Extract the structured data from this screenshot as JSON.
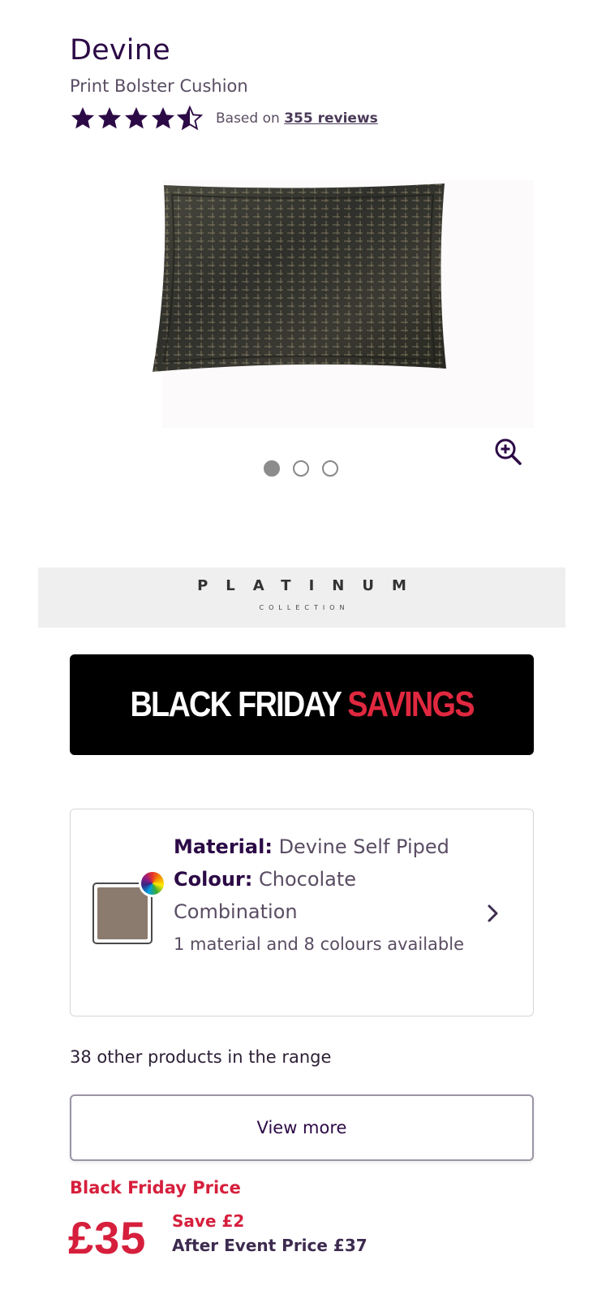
{
  "product": {
    "brand": "Devine",
    "subtitle": "Print Bolster Cushion",
    "rating": {
      "value_stars": 4.5,
      "max_stars": 5,
      "based_on_label": "Based on",
      "reviews_link": "355 reviews"
    }
  },
  "gallery": {
    "total_slides": 3,
    "active_slide": 1,
    "zoom_icon": "zoom-in-icon"
  },
  "collection_banner": {
    "title": "PLATINUM",
    "subtitle": "COLLECTION"
  },
  "promo_banner": {
    "text_white": "BLACK FRIDAY",
    "text_red": "SAVINGS",
    "red_color": "#e0283f"
  },
  "variant": {
    "material_label": "Material:",
    "material_value": "Devine Self Piped",
    "colour_label": "Colour:",
    "colour_value": "Chocolate Combination",
    "availability": "1 material and 8 colours available",
    "swatch_color": "#8b7b6e",
    "icon": "chevron-right-icon"
  },
  "range": {
    "text": "38 other products in the range",
    "button_label": "View more"
  },
  "pricing": {
    "label": "Black Friday Price",
    "price": "£35",
    "save": "Save £2",
    "after_event": "After Event Price £37",
    "accent_color": "#d61f3c"
  }
}
